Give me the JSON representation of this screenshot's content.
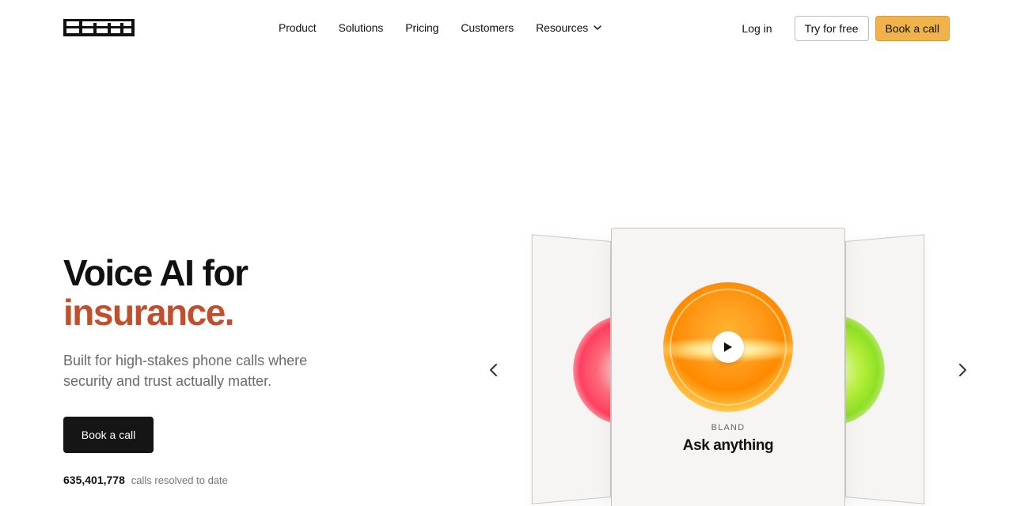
{
  "brand": {
    "logo_text": "bland"
  },
  "nav": {
    "links": [
      {
        "label": "Product"
      },
      {
        "label": "Solutions"
      },
      {
        "label": "Pricing"
      },
      {
        "label": "Customers"
      },
      {
        "label": "Resources",
        "icon": "chevron-down-icon"
      }
    ],
    "login_label": "Log in",
    "try_label": "Try for free",
    "book_label": "Book a call"
  },
  "hero": {
    "title_line1": "Voice AI for",
    "title_accent": "insurance.",
    "subtitle": "Built for high-stakes phone calls where security and trust actually matter.",
    "cta_label": "Book a call",
    "stat_number": "635,401,778",
    "stat_label": "calls resolved to date"
  },
  "carousel": {
    "card_brand": "BLAND",
    "card_title": "Ask anything",
    "prev_icon": "chevron-left-icon",
    "next_icon": "chevron-right-icon",
    "play_icon": "play-icon"
  },
  "colors": {
    "accent_text": "#c24e2b",
    "cta_orange": "#f0b24a",
    "dark_button": "#151515"
  }
}
